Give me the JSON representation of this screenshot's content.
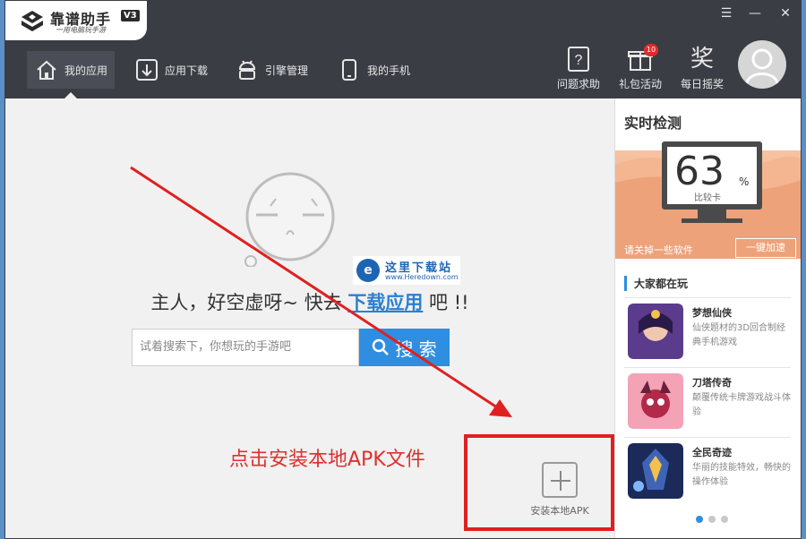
{
  "window": {
    "app_name": "靠谱助手",
    "version": "V3",
    "slogan": "一用电脑玩手游"
  },
  "controls": {
    "menu": "☰",
    "minimize": "—",
    "close": "✕"
  },
  "nav": {
    "items": [
      {
        "label": "我的应用",
        "icon": "home-icon"
      },
      {
        "label": "应用下载",
        "icon": "download-icon"
      },
      {
        "label": "引擎管理",
        "icon": "android-icon"
      },
      {
        "label": "我的手机",
        "icon": "phone-icon"
      }
    ]
  },
  "tools": [
    {
      "label": "问题求助",
      "icon": "help-icon"
    },
    {
      "label": "礼包活动",
      "icon": "gift-icon",
      "badge": "10"
    },
    {
      "label": "每日摇奖",
      "icon": "lottery-icon",
      "glyph": "奖"
    }
  ],
  "empty": {
    "prefix": "主人，好空虚呀~ 快去 ",
    "link": "下载应用",
    "suffix": " 吧 !!"
  },
  "search": {
    "placeholder": "试着搜索下，你想玩的手游吧",
    "button": "搜 索"
  },
  "watermark": {
    "title": "这里下载站",
    "url": "www.Heredown.com",
    "logo": "e"
  },
  "annotation": {
    "text": "点击安装本地APK文件"
  },
  "install": {
    "label": "安装本地APK"
  },
  "side": {
    "title": "实时检测",
    "meter_value": "63",
    "meter_unit": "%",
    "meter_label": "比较卡",
    "tip": "请关掉一些软件",
    "accel_button": "一键加速",
    "hot_title": "大家都在玩",
    "games": [
      {
        "name": "梦想仙侠",
        "desc": "仙侠题材的3D回合制经典手机游戏"
      },
      {
        "name": "刀塔传奇",
        "desc": "颠覆传统卡牌游戏战斗体验"
      },
      {
        "name": "全民奇迹",
        "desc": "华丽的技能特效，畅快的操作体验"
      }
    ]
  },
  "colors": {
    "titlebar": "#3b3d44",
    "accent": "#2f8ee0",
    "annotation": "#e02020",
    "meter": "#eea27a"
  }
}
